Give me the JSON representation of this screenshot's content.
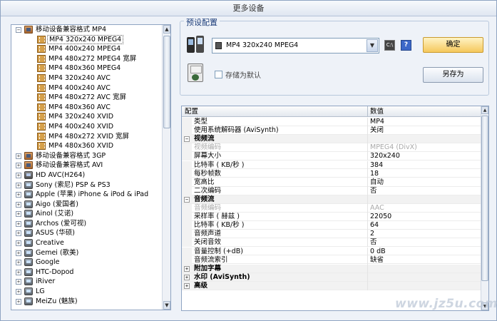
{
  "window": {
    "title": "更多设备"
  },
  "tree": {
    "nodes": [
      {
        "label": "移动设备兼容格式 MP4",
        "level": 0,
        "expander": "−",
        "icon": "group-device-icon",
        "selected": false
      },
      {
        "label": "MP4 320x240 MPEG4",
        "level": 1,
        "expander": "",
        "icon": "film-icon",
        "selected": true
      },
      {
        "label": "MP4 400x240 MPEG4",
        "level": 1,
        "expander": "",
        "icon": "film-icon",
        "selected": false
      },
      {
        "label": "MP4 480x272 MPEG4 宽屏",
        "level": 1,
        "expander": "",
        "icon": "film-icon",
        "selected": false
      },
      {
        "label": "MP4 480x360 MPEG4",
        "level": 1,
        "expander": "",
        "icon": "film-icon",
        "selected": false
      },
      {
        "label": "MP4 320x240 AVC",
        "level": 1,
        "expander": "",
        "icon": "film-icon",
        "selected": false
      },
      {
        "label": "MP4 400x240 AVC",
        "level": 1,
        "expander": "",
        "icon": "film-icon",
        "selected": false
      },
      {
        "label": "MP4 480x272 AVC 宽屏",
        "level": 1,
        "expander": "",
        "icon": "film-icon",
        "selected": false
      },
      {
        "label": "MP4 480x360 AVC",
        "level": 1,
        "expander": "",
        "icon": "film-icon",
        "selected": false
      },
      {
        "label": "MP4 320x240 XVID",
        "level": 1,
        "expander": "",
        "icon": "film-icon",
        "selected": false
      },
      {
        "label": "MP4 400x240 XVID",
        "level": 1,
        "expander": "",
        "icon": "film-icon",
        "selected": false
      },
      {
        "label": "MP4 480x272 XVID 宽屏",
        "level": 1,
        "expander": "",
        "icon": "film-icon",
        "selected": false
      },
      {
        "label": "MP4 480x360 XVID",
        "level": 1,
        "expander": "",
        "icon": "film-icon",
        "selected": false
      },
      {
        "label": "移动设备兼容格式 3GP",
        "level": 0,
        "expander": "+",
        "icon": "group-device-icon",
        "selected": false
      },
      {
        "label": "移动设备兼容格式 AVI",
        "level": 0,
        "expander": "+",
        "icon": "group-device-icon",
        "selected": false
      },
      {
        "label": "HD AVC(H264)",
        "level": 0,
        "expander": "+",
        "icon": "hd-device-icon",
        "selected": false
      },
      {
        "label": "Sony (索尼) PSP & PS3",
        "level": 0,
        "expander": "+",
        "icon": "device-icon",
        "selected": false
      },
      {
        "label": "Apple (苹果) iPhone & iPod & iPad",
        "level": 0,
        "expander": "+",
        "icon": "device-icon",
        "selected": false
      },
      {
        "label": "Aigo (爱国者)",
        "level": 0,
        "expander": "+",
        "icon": "device-icon",
        "selected": false
      },
      {
        "label": "Ainol (艾诺)",
        "level": 0,
        "expander": "+",
        "icon": "device-icon",
        "selected": false
      },
      {
        "label": "Archos (爱可视)",
        "level": 0,
        "expander": "+",
        "icon": "device-icon",
        "selected": false
      },
      {
        "label": "ASUS (华硕)",
        "level": 0,
        "expander": "+",
        "icon": "device-icon",
        "selected": false
      },
      {
        "label": "Creative",
        "level": 0,
        "expander": "+",
        "icon": "device-icon",
        "selected": false
      },
      {
        "label": "Gemei (歌美)",
        "level": 0,
        "expander": "+",
        "icon": "device-icon",
        "selected": false
      },
      {
        "label": "Google",
        "level": 0,
        "expander": "+",
        "icon": "device-icon",
        "selected": false
      },
      {
        "label": "HTC-Dopod",
        "level": 0,
        "expander": "+",
        "icon": "device-icon",
        "selected": false
      },
      {
        "label": "iRiver",
        "level": 0,
        "expander": "+",
        "icon": "device-icon",
        "selected": false
      },
      {
        "label": "LG",
        "level": 0,
        "expander": "+",
        "icon": "device-icon",
        "selected": false
      },
      {
        "label": "MeiZu (魅族)",
        "level": 0,
        "expander": "+",
        "icon": "device-icon",
        "selected": false
      }
    ]
  },
  "preset": {
    "legend": "预设配置",
    "selected": "MP4 320x240 MPEG4",
    "dropdown_arrow": "▼",
    "cmd_label": "C:\\",
    "help_label": "?",
    "ok_label": "确定",
    "save_default_label": "存储为默认",
    "save_as_label": "另存为"
  },
  "props": {
    "col_setting": "配置",
    "col_value": "数值",
    "rows": [
      {
        "type": "item",
        "key": "类型",
        "value": "MP4",
        "disabled": false
      },
      {
        "type": "item",
        "key": "使用系统解码器 (AviSynth)",
        "value": "关闭",
        "disabled": false
      },
      {
        "type": "cat",
        "key": "视频流",
        "value": "",
        "expander": "−"
      },
      {
        "type": "item",
        "key": "视频编码",
        "value": "MPEG4 (DivX)",
        "disabled": true
      },
      {
        "type": "item",
        "key": "屏幕大小",
        "value": "320x240",
        "disabled": false
      },
      {
        "type": "item",
        "key": "比特率 ( KB/秒 )",
        "value": "384",
        "disabled": false
      },
      {
        "type": "item",
        "key": "每秒帧数",
        "value": "18",
        "disabled": false
      },
      {
        "type": "item",
        "key": "宽高比",
        "value": "自动",
        "disabled": false
      },
      {
        "type": "item",
        "key": "二次编码",
        "value": "否",
        "disabled": false
      },
      {
        "type": "cat",
        "key": "音频流",
        "value": "",
        "expander": "−"
      },
      {
        "type": "item",
        "key": "音频编码",
        "value": "AAC",
        "disabled": true
      },
      {
        "type": "item",
        "key": "采样率 ( 赫兹 )",
        "value": "22050",
        "disabled": false
      },
      {
        "type": "item",
        "key": "比特率 ( KB/秒 )",
        "value": "64",
        "disabled": false
      },
      {
        "type": "item",
        "key": "音频声道",
        "value": "2",
        "disabled": false
      },
      {
        "type": "item",
        "key": "关闭音效",
        "value": "否",
        "disabled": false
      },
      {
        "type": "item",
        "key": "音量控制 (+dB)",
        "value": "0 dB",
        "disabled": false
      },
      {
        "type": "item",
        "key": "音频流索引",
        "value": "缺省",
        "disabled": false
      },
      {
        "type": "cat",
        "key": "附加字幕",
        "value": "",
        "expander": "+"
      },
      {
        "type": "cat",
        "key": "水印 (AviSynth)",
        "value": "",
        "expander": "+"
      },
      {
        "type": "cat",
        "key": "高级",
        "value": "",
        "expander": "+"
      }
    ]
  },
  "scroll": {
    "up": "▲",
    "down": "▼"
  },
  "watermark": "www.jz5u.com"
}
